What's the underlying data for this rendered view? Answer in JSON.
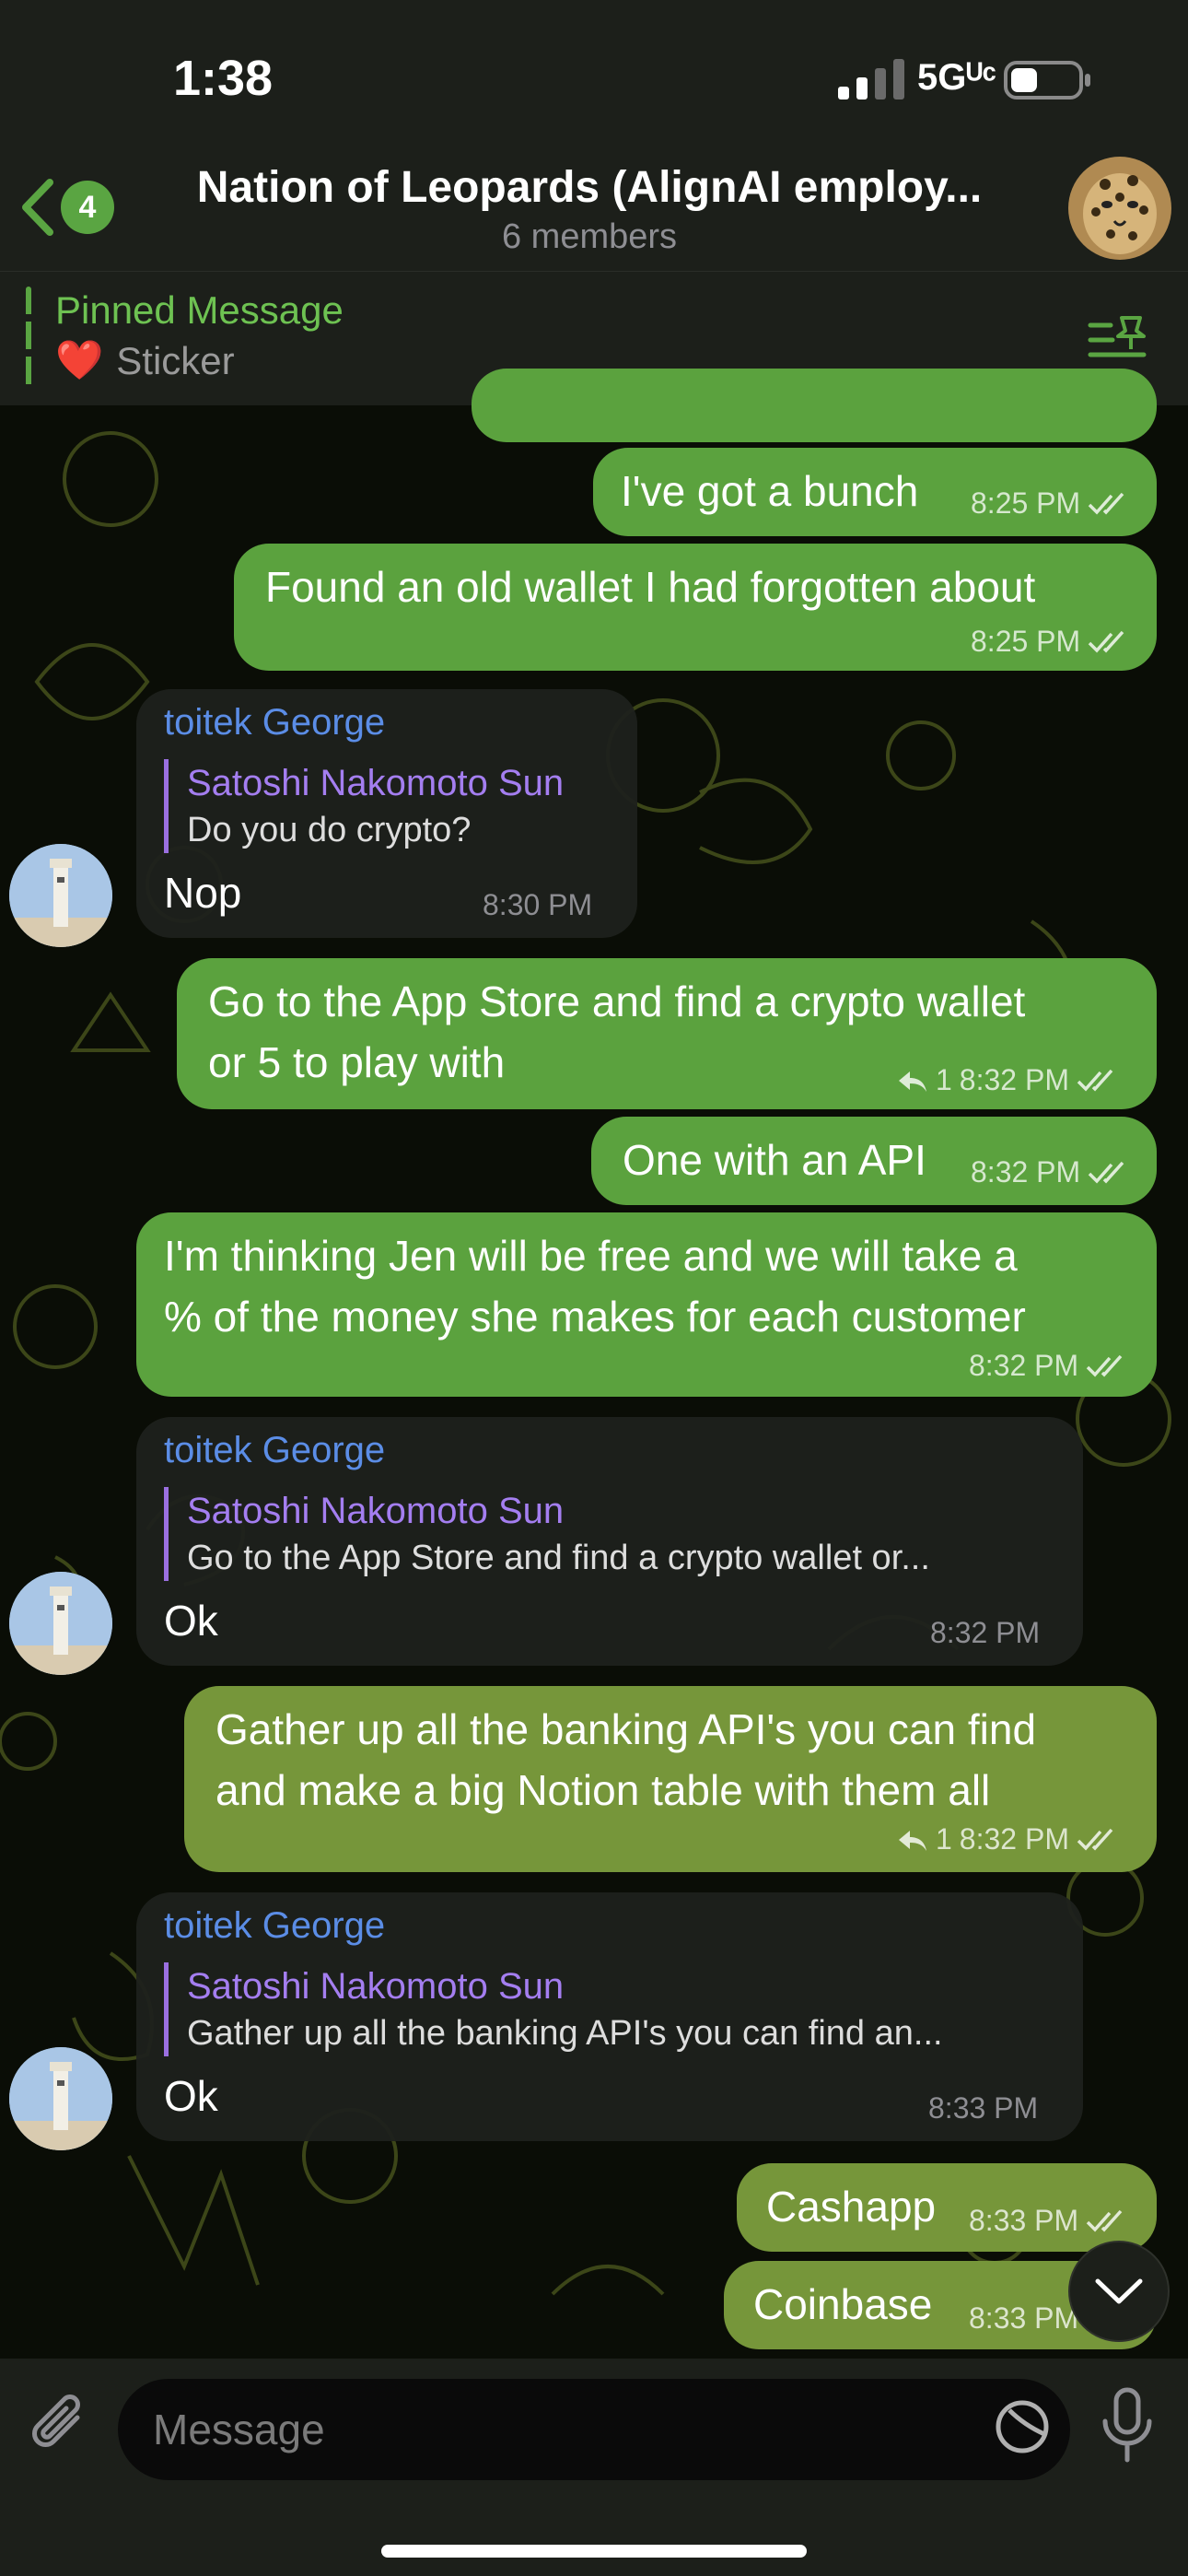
{
  "status_bar": {
    "time": "1:38",
    "network": "5Gᵁᶜ",
    "battery_percent": 40
  },
  "header": {
    "back_count": "4",
    "title": "Nation of Leopards (AlignAI employ...",
    "subtitle": "6 members"
  },
  "pinned": {
    "title": "Pinned Message",
    "emoji": "❤️",
    "text": "Sticker"
  },
  "messages": [
    {
      "type": "out",
      "text": "I've got a bunch",
      "time": "8:25 PM"
    },
    {
      "type": "out",
      "text": "Found an old wallet I had forgotten about",
      "time": "8:25 PM"
    },
    {
      "type": "in",
      "sender": "toitek George",
      "quote_name": "Satoshi Nakomoto Sun",
      "quote_text": "Do you do crypto?",
      "text": "Nop",
      "time": "8:30 PM"
    },
    {
      "type": "out",
      "line1": "Go to the App Store and find a crypto wallet",
      "line2": "or 5 to play with",
      "replies": "1",
      "time": "8:32 PM"
    },
    {
      "type": "out",
      "text": "One with an API",
      "time": "8:32 PM"
    },
    {
      "type": "out",
      "line1": "I'm thinking Jen will be free and we will take a",
      "line2": "% of the money she makes for each customer",
      "time": "8:32 PM"
    },
    {
      "type": "in",
      "sender": "toitek George",
      "quote_name": "Satoshi Nakomoto Sun",
      "quote_text": "Go to the App Store and find a crypto wallet or...",
      "text": "Ok",
      "time": "8:32 PM"
    },
    {
      "type": "out",
      "line1": "Gather up all the banking API's you can find",
      "line2": "and make a big Notion table with them all",
      "replies": "1",
      "time": "8:32 PM"
    },
    {
      "type": "in",
      "sender": "toitek George",
      "quote_name": "Satoshi Nakomoto Sun",
      "quote_text": "Gather up all the banking API's you can find an...",
      "text": "Ok",
      "time": "8:33 PM"
    },
    {
      "type": "out",
      "text": "Cashapp",
      "time": "8:33 PM"
    },
    {
      "type": "out",
      "text": "Coinbase",
      "time": "8:33 PM"
    }
  ],
  "input": {
    "placeholder": "Message"
  },
  "colors": {
    "outgoing": "#5ba23e",
    "incoming": "#1e211c",
    "accent": "#5aa542",
    "sender": "#5b8de6",
    "quote": "#a47ef0"
  }
}
